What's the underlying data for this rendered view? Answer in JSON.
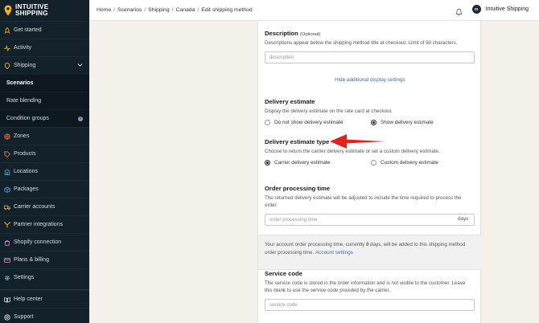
{
  "brand": {
    "line1": "INTUITIVE",
    "line2": "SHIPPING"
  },
  "sidebar": {
    "items": [
      {
        "label": "Get started",
        "icon": "rocket-icon"
      },
      {
        "label": "Activity",
        "icon": "activity-icon"
      },
      {
        "label": "Shipping",
        "icon": "pin-icon"
      },
      {
        "label": "Scenarios"
      },
      {
        "label": "Rate blending"
      },
      {
        "label": "Condition groups",
        "badge": "i"
      },
      {
        "label": "Zones",
        "icon": "globe-icon"
      },
      {
        "label": "Products",
        "icon": "tag-icon"
      },
      {
        "label": "Locations",
        "icon": "building-icon"
      },
      {
        "label": "Packages",
        "icon": "package-icon"
      },
      {
        "label": "Carrier accounts",
        "icon": "truck-icon"
      },
      {
        "label": "Partner integrations",
        "icon": "integration-icon"
      },
      {
        "label": "Shopify connection",
        "icon": "shopify-icon"
      },
      {
        "label": "Plans & billing",
        "icon": "card-icon"
      },
      {
        "label": "Settings",
        "icon": "gear-icon"
      },
      {
        "label": "Help center",
        "icon": "help-icon"
      },
      {
        "label": "Support",
        "icon": "support-icon"
      }
    ]
  },
  "breadcrumb": [
    "Home",
    "Scenarios",
    "Shipping",
    "Canada",
    "Edit shipping method"
  ],
  "user": {
    "initials": "IS",
    "name": "Intuitive Shipping"
  },
  "form": {
    "description": {
      "title": "Description",
      "optional": "(Optional)",
      "help": "Descriptions appear below the shipping method title at checkout. Limit of 90 characters.",
      "placeholder": "description"
    },
    "hide_link": "Hide additional display settings",
    "delivery_estimate": {
      "title": "Delivery estimate",
      "help": "Display the delivery estimate on the rate card at checkout.",
      "options": [
        "Do not show delivery estimate",
        "Show delivery estimate"
      ],
      "selected": "Show delivery estimate"
    },
    "estimate_type": {
      "title": "Delivery estimate type",
      "help": "Choose to return the carrier delivery estimate or set a custom delivery estimate.",
      "options": [
        "Carrier delivery estimate",
        "Custom delivery estimate"
      ],
      "selected": "Carrier delivery estimate"
    },
    "processing": {
      "title": "Order processing time",
      "help_line1": "The returned delivery estimate will be adjusted to include the time required to process the",
      "help_line2": "order.",
      "placeholder": "order processing time",
      "suffix": "days"
    },
    "note": {
      "line1_prefix": "Your account order processing time, currently ",
      "line1_value": "0",
      "line1_suffix": " days, will be added to this shipping method",
      "line2_prefix": "order processing time. ",
      "line2_link": "Account settings"
    },
    "service_code": {
      "title": "Service code",
      "help_line1": "The service code is stored in the order information and is not visible to the customer. Leave",
      "help_line2": "this blank to use the service code provided by the carrier.",
      "placeholder": "service code"
    }
  },
  "colors": {
    "sidebar_bg": "#13212b",
    "page_bg": "#f4f1ea",
    "link": "#3a6fb0",
    "arrow": "#e3231b"
  }
}
